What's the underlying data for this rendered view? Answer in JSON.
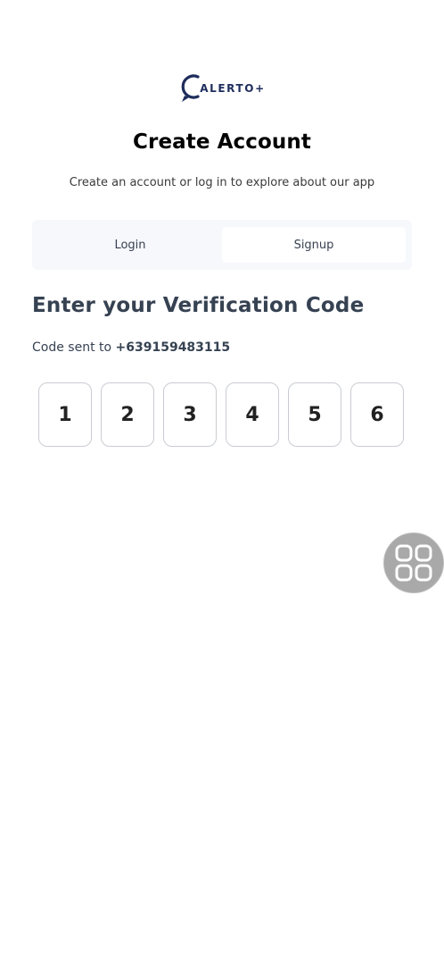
{
  "logo": {
    "text": "ALERTO+",
    "brand_color": "#1e2d5c"
  },
  "header": {
    "title": "Create Account",
    "subtitle": "Create an account or log in to explore about our app"
  },
  "tabs": [
    {
      "label": "Login",
      "active": false
    },
    {
      "label": "Signup",
      "active": true
    }
  ],
  "verification": {
    "heading": "Enter your Verification Code",
    "sent_prefix": "Code sent to ",
    "phone": "+639159483115",
    "digits": [
      "1",
      "2",
      "3",
      "4",
      "5",
      "6"
    ]
  },
  "floating_button": {
    "icon": "grid-icon"
  },
  "colors": {
    "background": "#ffffff",
    "tab_bg": "#f6f8fc",
    "heading": "#364252",
    "otp_border": "#c9ccd2",
    "float_button": "#a9a9a9"
  }
}
